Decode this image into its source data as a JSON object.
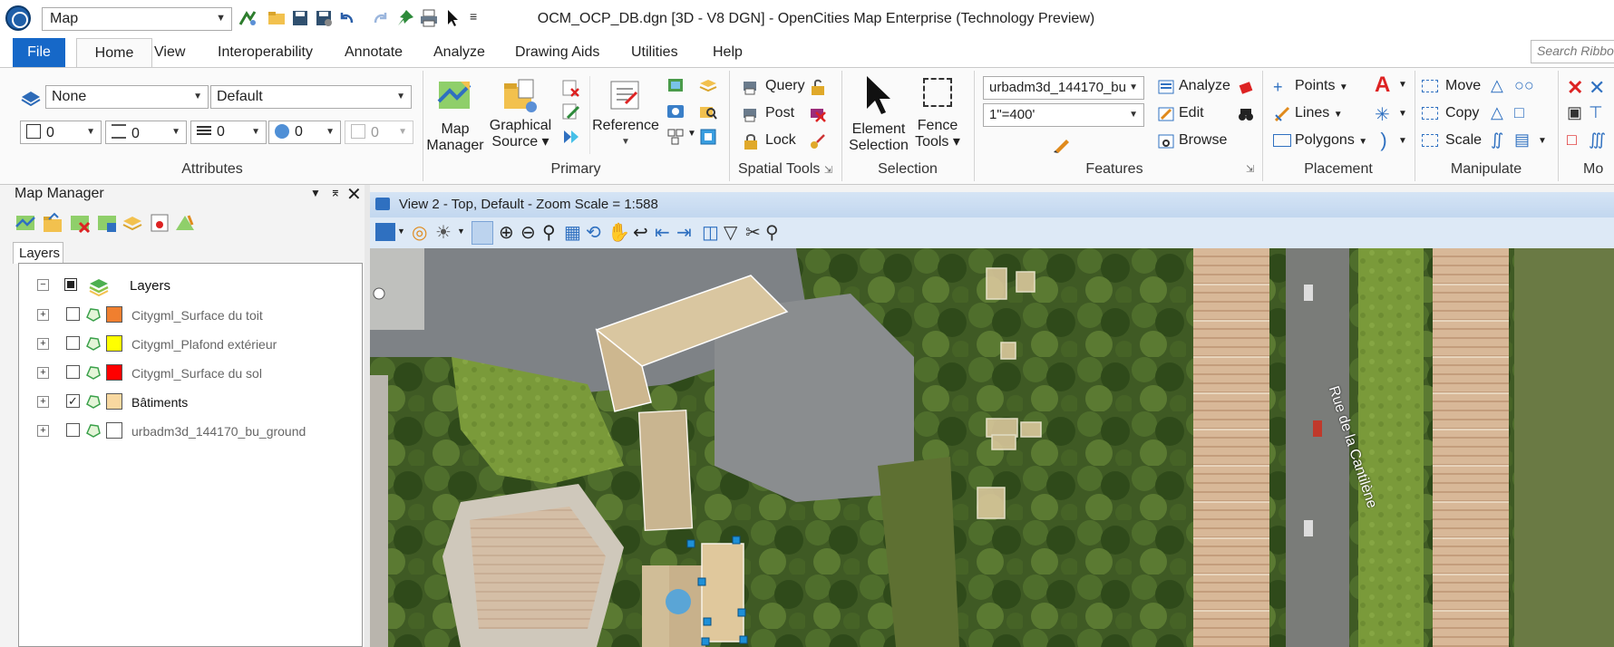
{
  "app": {
    "workflow": "Map",
    "title": "OCM_OCP_DB.dgn [3D - V8 DGN] - OpenCities Map Enterprise (Technology Preview)"
  },
  "tabs": [
    "File",
    "Home",
    "View",
    "Interoperability",
    "Annotate",
    "Analyze",
    "Drawing Aids",
    "Utilities",
    "Help"
  ],
  "search": {
    "placeholder": "Search Ribbon"
  },
  "attributes": {
    "level": "None",
    "style": "Default",
    "color": "0",
    "weight": "0",
    "linestyle": "0",
    "transparency": "0",
    "priority": "0",
    "label": "Attributes"
  },
  "primary": {
    "map_manager": [
      "Map",
      "Manager"
    ],
    "graphical_source": [
      "Graphical",
      "Source ▾"
    ],
    "reference": "Reference",
    "label": "Primary"
  },
  "spatial": {
    "query": "Query",
    "post": "Post",
    "lock": "Lock",
    "label": "Spatial Tools"
  },
  "selection": {
    "element_selection": [
      "Element",
      "Selection"
    ],
    "fence_tools": [
      "Fence",
      "Tools ▾"
    ],
    "label": "Selection"
  },
  "features": {
    "feature_name": "urbadm3d_144170_bu",
    "scale": "1\"=400'",
    "analyze": "Analyze",
    "edit": "Edit",
    "browse": "Browse",
    "label": "Features"
  },
  "placement": {
    "points": "Points",
    "lines": "Lines",
    "polygons": "Polygons",
    "label": "Placement"
  },
  "manipulate": {
    "move": "Move",
    "copy": "Copy",
    "scale": "Scale",
    "label": "Manipulate",
    "next_label": "Mo"
  },
  "map_manager": {
    "title": "Map Manager",
    "tab": "Layers",
    "root": "Layers",
    "layers": [
      {
        "name": "Citygml_Surface du toit",
        "checked": false,
        "color": "#f07f2f"
      },
      {
        "name": "Citygml_Plafond extérieur",
        "checked": false,
        "color": "#ffff00"
      },
      {
        "name": "Citygml_Surface du sol",
        "checked": false,
        "color": "#ff0000"
      },
      {
        "name": "Bâtiments",
        "checked": true,
        "color": "#f8d8a0"
      },
      {
        "name": "urbadm3d_144170_bu_ground",
        "checked": false,
        "color": "#ffffff"
      }
    ]
  },
  "view": {
    "title": "View 2 - Top, Default - Zoom Scale = 1:588",
    "street_label": "Rue de la Cantilène"
  }
}
